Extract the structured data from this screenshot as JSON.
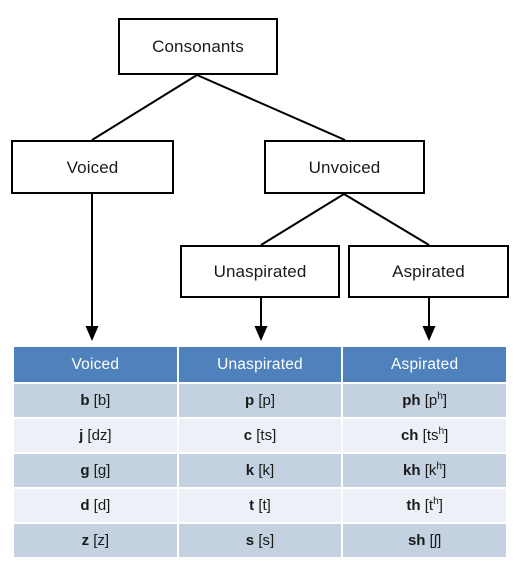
{
  "diagram": {
    "title_node": {
      "label": "Consonants"
    },
    "level2": [
      {
        "label": "Voiced"
      },
      {
        "label": "Unvoiced"
      }
    ],
    "level3": [
      {
        "label": "Unaspirated"
      },
      {
        "label": "Aspirated"
      }
    ]
  },
  "chart_data": {
    "type": "table",
    "title": "",
    "columns": [
      "Voiced",
      "Unaspirated",
      "Aspirated"
    ],
    "rows": [
      [
        "b [b]",
        "p [p]",
        "ph [pʰ]"
      ],
      [
        "j [dz]",
        "c [ts]",
        "ch [tsʰ]"
      ],
      [
        "g [g]",
        "k [k]",
        "kh [kʰ]"
      ],
      [
        "d [d]",
        "t [t]",
        "th [tʰ]"
      ],
      [
        "z [z]",
        "s [s]",
        "sh [ʃ]"
      ]
    ],
    "header_color": "#4F81BD",
    "row_band_colors": [
      "#C3D1E0",
      "#EDF1F7"
    ]
  },
  "table": {
    "headers": [
      {
        "label": "Voiced"
      },
      {
        "label": "Unaspirated"
      },
      {
        "label": "Aspirated"
      }
    ],
    "rows": [
      {
        "voiced": {
          "letter": "b",
          "ipa": "[b]"
        },
        "unaspirated": {
          "letter": "p",
          "ipa": "[p]"
        },
        "aspirated": {
          "letter": "ph",
          "ipa_pre": "[p",
          "ipa_sup": "h",
          "ipa_post": "]"
        }
      },
      {
        "voiced": {
          "letter": "j",
          "ipa": "[dz]"
        },
        "unaspirated": {
          "letter": "c",
          "ipa": "[ts]"
        },
        "aspirated": {
          "letter": "ch",
          "ipa_pre": "[ts",
          "ipa_sup": "h",
          "ipa_post": "]"
        }
      },
      {
        "voiced": {
          "letter": "g",
          "ipa": "[g]"
        },
        "unaspirated": {
          "letter": "k",
          "ipa": "[k]"
        },
        "aspirated": {
          "letter": "kh",
          "ipa_pre": "[k",
          "ipa_sup": "h",
          "ipa_post": "]"
        }
      },
      {
        "voiced": {
          "letter": "d",
          "ipa": "[d]"
        },
        "unaspirated": {
          "letter": "t",
          "ipa": "[t]"
        },
        "aspirated": {
          "letter": "th",
          "ipa_pre": "[t",
          "ipa_sup": "h",
          "ipa_post": "]"
        }
      },
      {
        "voiced": {
          "letter": "z",
          "ipa": "[z]"
        },
        "unaspirated": {
          "letter": "s",
          "ipa": "[s]"
        },
        "aspirated": {
          "letter": "sh",
          "ipa_pre": "[ʃ",
          "ipa_sup": "",
          "ipa_post": "]"
        }
      }
    ]
  }
}
